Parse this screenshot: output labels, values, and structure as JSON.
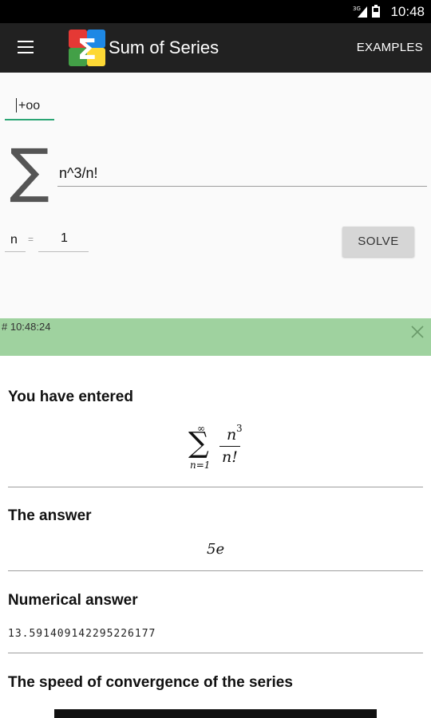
{
  "status_bar": {
    "time": "10:48",
    "network": "3G",
    "icons": [
      "signal-icon",
      "battery-icon"
    ]
  },
  "app_bar": {
    "title": "Sum of Series",
    "examples_label": "EXAMPLES",
    "menu_icon": "hamburger-menu-icon",
    "logo_glyph": "Σ"
  },
  "input": {
    "upper_limit": "+oo",
    "sigma": "∑",
    "expression": "n^3/n!",
    "variable": "n",
    "equals": "=",
    "lower_limit": "1",
    "solve_label": "SOLVE"
  },
  "result": {
    "timestamp": "# 10:48:24",
    "entered_title": "You have entered",
    "entered_formula": {
      "upper": "∞",
      "sigma": "∑",
      "lower": "n=1",
      "numerator": "n",
      "exponent": "3",
      "denominator": "n!"
    },
    "answer_title": "The answer",
    "answer": "5e",
    "numerical_title": "Numerical answer",
    "numerical_value": "13.591409142295226177",
    "convergence_title": "The speed of convergence of the series"
  },
  "colors": {
    "accent": "#2aa574",
    "app_bar": "#212121",
    "result_header": "#9fd29f"
  }
}
